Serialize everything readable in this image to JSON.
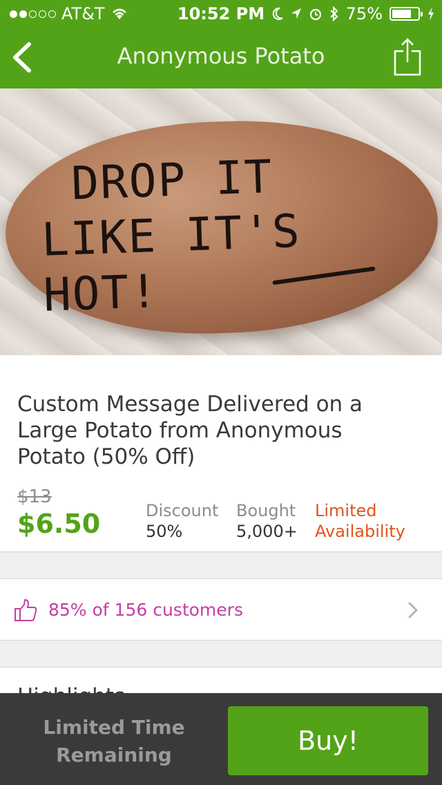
{
  "status_bar": {
    "carrier": "AT&T",
    "signal_bars_filled": 2,
    "signal_bars_total": 5,
    "time": "10:52 PM",
    "battery_percent": "75%",
    "battery_level": 0.75,
    "icons": [
      "wifi-icon",
      "moon-icon",
      "location-icon",
      "alarm-icon",
      "bluetooth-icon",
      "charging-icon"
    ]
  },
  "navbar": {
    "title": "Anonymous Potato",
    "back_icon": "chevron-left-icon",
    "share_icon": "share-icon"
  },
  "hero": {
    "image": "potato-photo",
    "potato_text_line1": "DROP IT",
    "potato_text_line2": "LIKE IT'S HOT!"
  },
  "deal": {
    "title": "Custom Message Delivered on a Large Potato from Anonymous Potato (50% Off)",
    "original_price": "$13",
    "price": "$6.50",
    "discount_label": "Discount",
    "discount_value": "50%",
    "bought_label": "Bought",
    "bought_value": "5,000+",
    "limited_line1": "Limited",
    "limited_line2": "Availability"
  },
  "rating": {
    "text": "85% of 156 customers",
    "icon": "thumbs-up-icon"
  },
  "highlights": {
    "label": "Highlights"
  },
  "bottom_bar": {
    "time_line1": "Limited Time",
    "time_line2": "Remaining",
    "buy_label": "Buy!"
  },
  "colors": {
    "brand_green": "#53a318",
    "limited_orange": "#e0541e",
    "rating_magenta": "#c43ea3",
    "bottom_bar": "#3a3a3a"
  }
}
